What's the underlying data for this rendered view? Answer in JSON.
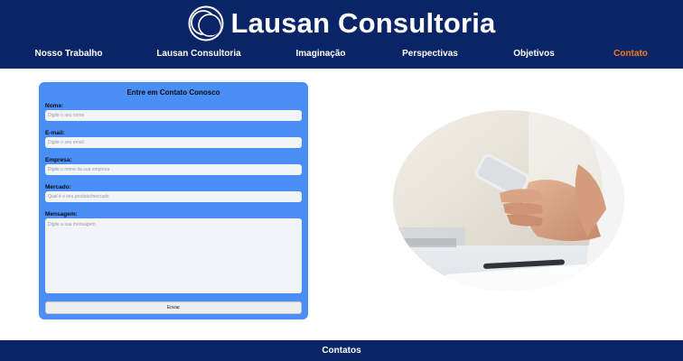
{
  "header": {
    "brand_title": "Lausan Consultoria",
    "logo_icon": "crescent-circles-logo",
    "background_color": "#0a2468"
  },
  "nav": {
    "items": [
      {
        "label": "Nosso Trabalho"
      },
      {
        "label": "Lausan Consultoria"
      },
      {
        "label": "Imaginação"
      },
      {
        "label": "Perspectivas"
      },
      {
        "label": "Objetivos"
      },
      {
        "label": "Contato"
      }
    ],
    "active_color": "#f07d1a"
  },
  "form": {
    "title": "Entre em Contato Conosco",
    "card_color": "#4a8ff7",
    "fields": [
      {
        "label": "Nome:",
        "placeholder": "Digite o seu nome"
      },
      {
        "label": "E-mail:",
        "placeholder": "Digite o seu email"
      },
      {
        "label": "Empresa:",
        "placeholder": "Digite o nome da sua empresa"
      },
      {
        "label": "Mercado:",
        "placeholder": "Qual é o seu produto/mercado"
      }
    ],
    "message": {
      "label": "Mensagem:",
      "placeholder": "Digite a sua mensagem"
    },
    "submit_label": "Enviar"
  },
  "image": {
    "subject": "hands-holding-smartphone-photo"
  },
  "footer": {
    "label": "Contatos"
  }
}
